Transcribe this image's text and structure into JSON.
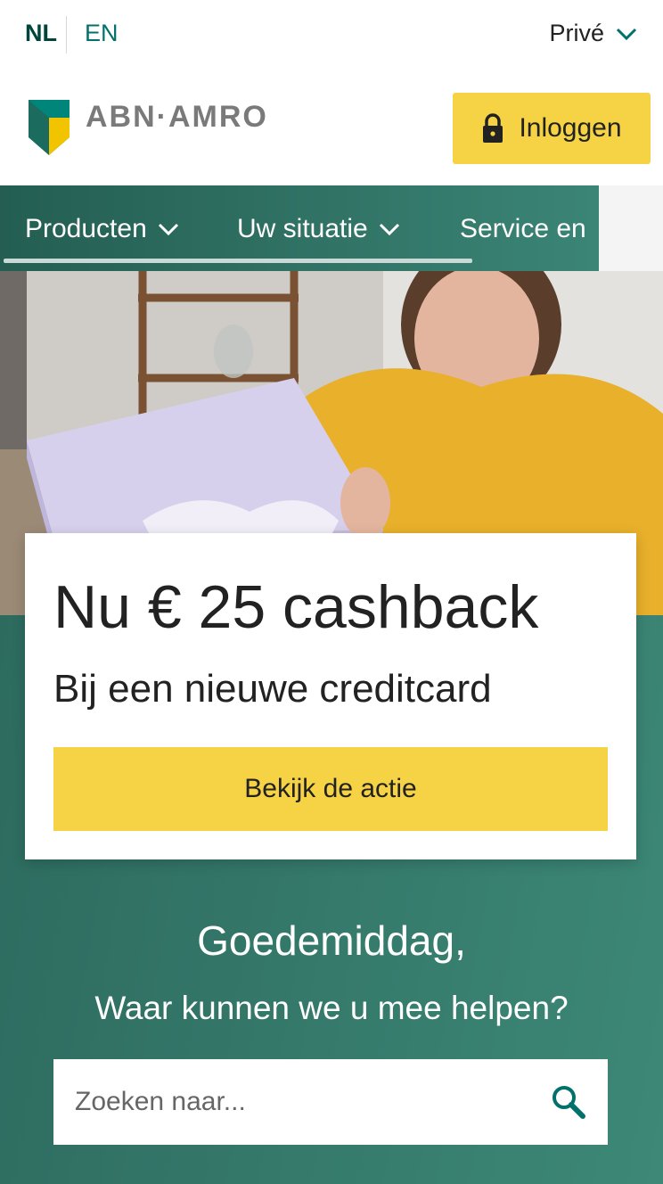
{
  "language": {
    "nl": "NL",
    "en": "EN"
  },
  "segment": {
    "label": "Privé"
  },
  "header": {
    "brand": "ABN·AMRO",
    "login_label": "Inloggen"
  },
  "nav": {
    "items": [
      {
        "label": "Producten"
      },
      {
        "label": "Uw situatie"
      },
      {
        "label": "Service en"
      }
    ]
  },
  "promo": {
    "title": "Nu € 25 cashback",
    "subtitle": "Bij een nieuwe creditcard",
    "cta_label": "Bekijk de actie"
  },
  "greeting": {
    "title": "Goedemiddag,",
    "question": "Waar kunnen we u mee helpen?"
  },
  "search": {
    "placeholder": "Zoeken naar..."
  },
  "colors": {
    "brand_green": "#00716b",
    "nav_green": "#245e52",
    "accent_yellow": "#f6d245"
  }
}
